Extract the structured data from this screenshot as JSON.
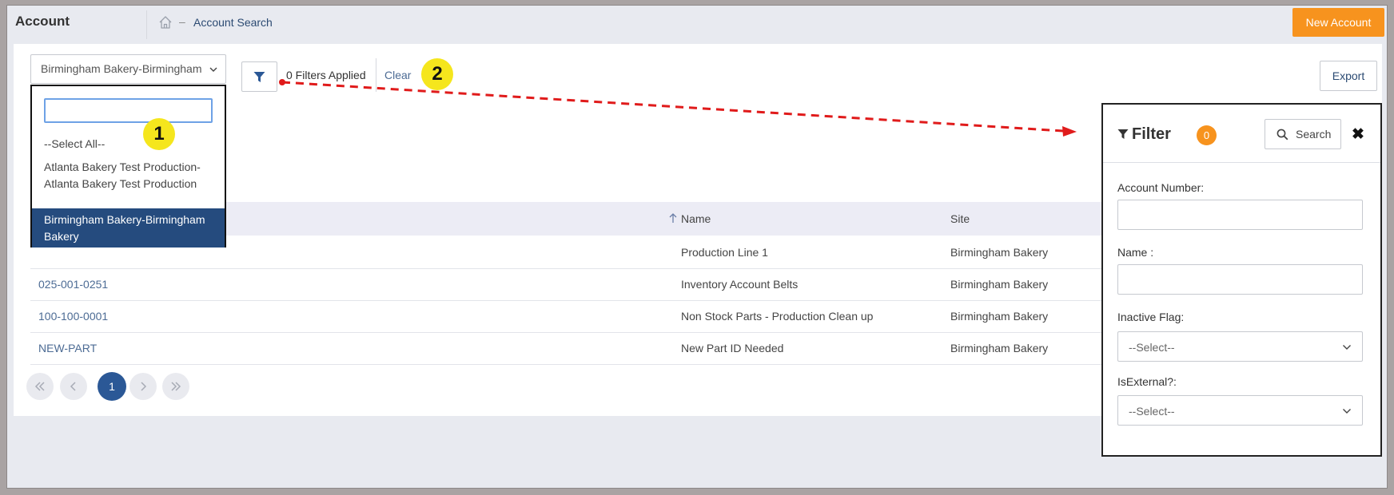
{
  "header": {
    "app_title": "Account",
    "breadcrumb_separator": "–",
    "breadcrumb_current": "Account Search",
    "new_account_label": "New Account"
  },
  "toolbar": {
    "site_select_value": "Birmingham Bakery-Birmingham Bakery",
    "filters_applied_text": "0 Filters Applied",
    "clear_label": "Clear",
    "export_label": "Export"
  },
  "site_dropdown": {
    "search_value": "",
    "options": [
      "--Select All--",
      "Atlanta Bakery Test Production-Atlanta Bakery Test Production",
      "Birmingham Bakery-Birmingham Bakery"
    ],
    "selected_index": 2
  },
  "table": {
    "columns": [
      "Name",
      "Site"
    ],
    "sort_column": "Name",
    "rows": [
      {
        "account": "",
        "name": "Production Line 1",
        "site": "Birmingham Bakery"
      },
      {
        "account": "025-001-0251",
        "name": "Inventory Account Belts",
        "site": "Birmingham Bakery"
      },
      {
        "account": "100-100-0001",
        "name": "Non Stock Parts - Production Clean up",
        "site": "Birmingham Bakery"
      },
      {
        "account": "NEW-PART",
        "name": "New Part ID Needed",
        "site": "Birmingham Bakery"
      }
    ]
  },
  "pagination": {
    "current_page": "1",
    "first_icon": "double-chevron-left-icon",
    "prev_icon": "chevron-left-icon",
    "next_icon": "chevron-right-icon",
    "last_icon": "double-chevron-right-icon"
  },
  "filter_panel": {
    "title": "Filter",
    "count": "0",
    "search_label": "Search",
    "close_symbol": "✖",
    "fields": {
      "account_number_label": "Account Number:",
      "account_number_value": "",
      "name_label": "Name :",
      "name_value": "",
      "inactive_flag_label": "Inactive Flag:",
      "inactive_flag_value": "--Select--",
      "is_external_label": "IsExternal?:",
      "is_external_value": "--Select--"
    }
  },
  "annotations": {
    "marker_1": "1",
    "marker_2": "2",
    "arrow_color": "#e01b1b",
    "marker_color": "#f5e61d"
  },
  "colors": {
    "accent_orange": "#f7931e",
    "selected_blue": "#254b7e",
    "link_blue": "#4c6b94"
  }
}
